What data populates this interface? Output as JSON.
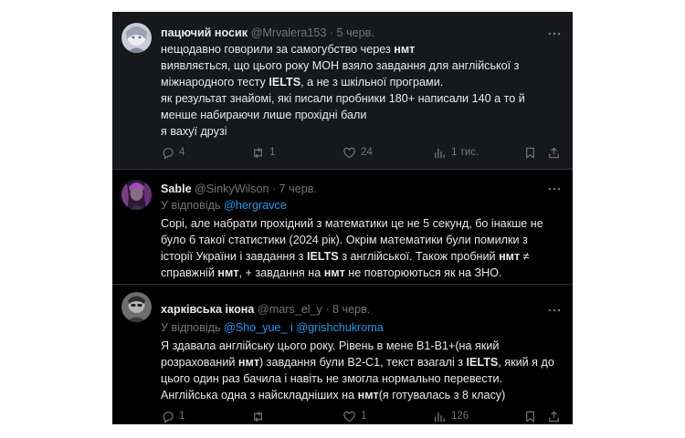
{
  "posts": [
    {
      "name": "пацючий носик",
      "handle": "@Mrvalera153",
      "date": "· 5 черв.",
      "body": [
        [
          {
            "t": "нещодавно говорили за самогубство через "
          },
          {
            "t": "нмт",
            "b": true
          }
        ],
        [
          {
            "t": "виявляється, що цього року МОН взяло завдання для англійської з"
          }
        ],
        [
          {
            "t": "міжнародного тесту "
          },
          {
            "t": "IELTS",
            "b": true
          },
          {
            "t": ", а не з шкільної програми."
          }
        ],
        [
          {
            "t": "як результат знайомі, які писали пробники 180+ написали 140 а то й"
          }
        ],
        [
          {
            "t": "менше набираючи лише прохідні бали"
          }
        ],
        [
          {
            "t": "я вахуї друзі"
          }
        ]
      ],
      "replies": "4",
      "reposts": "1",
      "likes": "24",
      "views": "1 тис."
    },
    {
      "name": "Sable",
      "handle": "@SinkyWilson",
      "date": "· 7 черв.",
      "reply_prefix": "У відповідь ",
      "reply_to": "@hergravce",
      "body": [
        [
          {
            "t": "Сорі, але набрати прохідний з математики це не 5 секунд, бо інакше не"
          }
        ],
        [
          {
            "t": "було б такої статистики (2024 рік). Окрім математики були помилки з"
          }
        ],
        [
          {
            "t": "історії України і завдання з "
          },
          {
            "t": "IELTS",
            "b": true
          },
          {
            "t": " з англійської. Також пробний "
          },
          {
            "t": "нмт",
            "b": true
          },
          {
            "t": " ≠"
          }
        ],
        [
          {
            "t": "справжній "
          },
          {
            "t": "нмт",
            "b": true
          },
          {
            "t": ", + завдання на "
          },
          {
            "t": "нмт",
            "b": true
          },
          {
            "t": " не повторюються як на ЗНО."
          }
        ]
      ]
    },
    {
      "name": "харківська ікона",
      "handle": "@mars_el_y",
      "date": "· 8 черв.",
      "reply_prefix": "У відповідь ",
      "reply_to": "@Sho_yue_ i @grishchukroma",
      "body": [
        [
          {
            "t": "Я здавала англійську цього року.  Рівень в мене B1-B1+(на який"
          }
        ],
        [
          {
            "t": "розрахований "
          },
          {
            "t": "нмт",
            "b": true
          },
          {
            "t": ") завдання були B2-C1, текст взагалі з "
          },
          {
            "t": "IELTS",
            "b": true
          },
          {
            "t": ", який я до"
          }
        ],
        [
          {
            "t": "цього один раз бачила і навіть не змогла нормально перевести."
          }
        ],
        [
          {
            "t": "Англійська одна з найскладніших на "
          },
          {
            "t": "нмт",
            "b": true
          },
          {
            "t": "(я готувалась з 8 класу)"
          }
        ]
      ],
      "replies": "1",
      "likes": "1",
      "views": "126"
    }
  ]
}
